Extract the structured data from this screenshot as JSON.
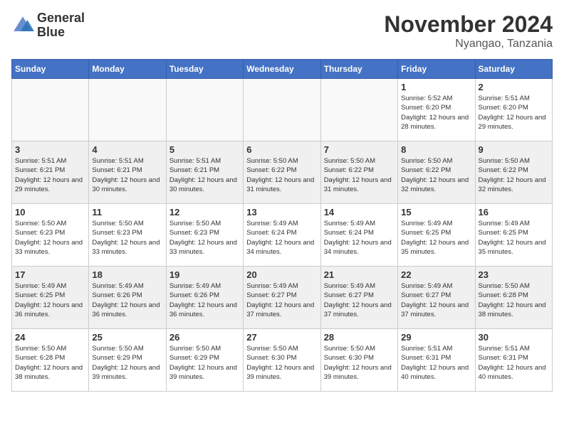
{
  "header": {
    "logo_line1": "General",
    "logo_line2": "Blue",
    "month_title": "November 2024",
    "location": "Nyangao, Tanzania"
  },
  "weekdays": [
    "Sunday",
    "Monday",
    "Tuesday",
    "Wednesday",
    "Thursday",
    "Friday",
    "Saturday"
  ],
  "weeks": [
    [
      {
        "day": "",
        "empty": true
      },
      {
        "day": "",
        "empty": true
      },
      {
        "day": "",
        "empty": true
      },
      {
        "day": "",
        "empty": true
      },
      {
        "day": "",
        "empty": true
      },
      {
        "day": "1",
        "sunrise": "5:52 AM",
        "sunset": "6:20 PM",
        "daylight": "12 hours and 28 minutes."
      },
      {
        "day": "2",
        "sunrise": "5:51 AM",
        "sunset": "6:20 PM",
        "daylight": "12 hours and 29 minutes."
      }
    ],
    [
      {
        "day": "3",
        "sunrise": "5:51 AM",
        "sunset": "6:21 PM",
        "daylight": "12 hours and 29 minutes."
      },
      {
        "day": "4",
        "sunrise": "5:51 AM",
        "sunset": "6:21 PM",
        "daylight": "12 hours and 30 minutes."
      },
      {
        "day": "5",
        "sunrise": "5:51 AM",
        "sunset": "6:21 PM",
        "daylight": "12 hours and 30 minutes."
      },
      {
        "day": "6",
        "sunrise": "5:50 AM",
        "sunset": "6:22 PM",
        "daylight": "12 hours and 31 minutes."
      },
      {
        "day": "7",
        "sunrise": "5:50 AM",
        "sunset": "6:22 PM",
        "daylight": "12 hours and 31 minutes."
      },
      {
        "day": "8",
        "sunrise": "5:50 AM",
        "sunset": "6:22 PM",
        "daylight": "12 hours and 32 minutes."
      },
      {
        "day": "9",
        "sunrise": "5:50 AM",
        "sunset": "6:22 PM",
        "daylight": "12 hours and 32 minutes."
      }
    ],
    [
      {
        "day": "10",
        "sunrise": "5:50 AM",
        "sunset": "6:23 PM",
        "daylight": "12 hours and 33 minutes."
      },
      {
        "day": "11",
        "sunrise": "5:50 AM",
        "sunset": "6:23 PM",
        "daylight": "12 hours and 33 minutes."
      },
      {
        "day": "12",
        "sunrise": "5:50 AM",
        "sunset": "6:23 PM",
        "daylight": "12 hours and 33 minutes."
      },
      {
        "day": "13",
        "sunrise": "5:49 AM",
        "sunset": "6:24 PM",
        "daylight": "12 hours and 34 minutes."
      },
      {
        "day": "14",
        "sunrise": "5:49 AM",
        "sunset": "6:24 PM",
        "daylight": "12 hours and 34 minutes."
      },
      {
        "day": "15",
        "sunrise": "5:49 AM",
        "sunset": "6:25 PM",
        "daylight": "12 hours and 35 minutes."
      },
      {
        "day": "16",
        "sunrise": "5:49 AM",
        "sunset": "6:25 PM",
        "daylight": "12 hours and 35 minutes."
      }
    ],
    [
      {
        "day": "17",
        "sunrise": "5:49 AM",
        "sunset": "6:25 PM",
        "daylight": "12 hours and 36 minutes."
      },
      {
        "day": "18",
        "sunrise": "5:49 AM",
        "sunset": "6:26 PM",
        "daylight": "12 hours and 36 minutes."
      },
      {
        "day": "19",
        "sunrise": "5:49 AM",
        "sunset": "6:26 PM",
        "daylight": "12 hours and 36 minutes."
      },
      {
        "day": "20",
        "sunrise": "5:49 AM",
        "sunset": "6:27 PM",
        "daylight": "12 hours and 37 minutes."
      },
      {
        "day": "21",
        "sunrise": "5:49 AM",
        "sunset": "6:27 PM",
        "daylight": "12 hours and 37 minutes."
      },
      {
        "day": "22",
        "sunrise": "5:49 AM",
        "sunset": "6:27 PM",
        "daylight": "12 hours and 37 minutes."
      },
      {
        "day": "23",
        "sunrise": "5:50 AM",
        "sunset": "6:28 PM",
        "daylight": "12 hours and 38 minutes."
      }
    ],
    [
      {
        "day": "24",
        "sunrise": "5:50 AM",
        "sunset": "6:28 PM",
        "daylight": "12 hours and 38 minutes."
      },
      {
        "day": "25",
        "sunrise": "5:50 AM",
        "sunset": "6:29 PM",
        "daylight": "12 hours and 39 minutes."
      },
      {
        "day": "26",
        "sunrise": "5:50 AM",
        "sunset": "6:29 PM",
        "daylight": "12 hours and 39 minutes."
      },
      {
        "day": "27",
        "sunrise": "5:50 AM",
        "sunset": "6:30 PM",
        "daylight": "12 hours and 39 minutes."
      },
      {
        "day": "28",
        "sunrise": "5:50 AM",
        "sunset": "6:30 PM",
        "daylight": "12 hours and 39 minutes."
      },
      {
        "day": "29",
        "sunrise": "5:51 AM",
        "sunset": "6:31 PM",
        "daylight": "12 hours and 40 minutes."
      },
      {
        "day": "30",
        "sunrise": "5:51 AM",
        "sunset": "6:31 PM",
        "daylight": "12 hours and 40 minutes."
      }
    ]
  ]
}
